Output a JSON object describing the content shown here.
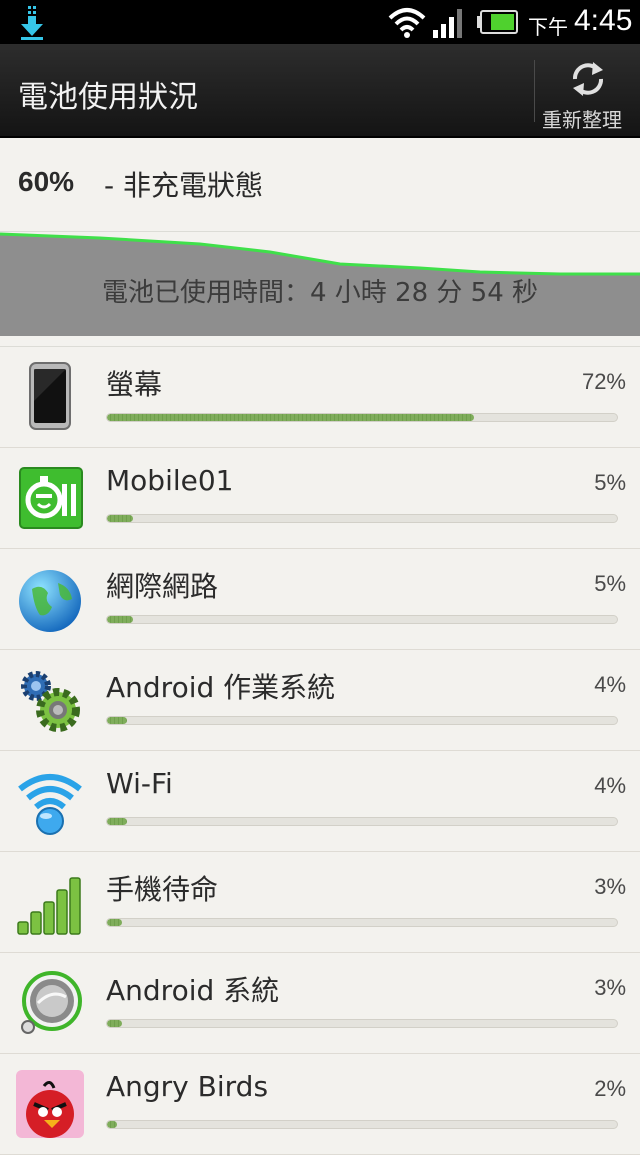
{
  "status_bar": {
    "ampm": "下午",
    "time": "4:45",
    "icons": [
      "download-icon",
      "wifi-icon",
      "signal-icon",
      "battery-icon"
    ]
  },
  "header": {
    "title": "電池使用狀況",
    "refresh_label": "重新整理"
  },
  "summary": {
    "percent": "60%",
    "state": "- 非充電狀態"
  },
  "graph": {
    "usage_text": "電池已使用時間：4 小時 28 分 54 秒",
    "line_color": "#3fe04a",
    "fill_color": "#8e8e8e"
  },
  "usage": {
    "items": [
      {
        "name": "螢幕",
        "percent": "72%",
        "fraction": 0.72,
        "icon": "phone-screen-icon"
      },
      {
        "name": "Mobile01",
        "percent": "5%",
        "fraction": 0.05,
        "icon": "mobile01-app-icon"
      },
      {
        "name": "網際網路",
        "percent": "5%",
        "fraction": 0.05,
        "icon": "globe-icon"
      },
      {
        "name": "Android 作業系統",
        "percent": "4%",
        "fraction": 0.04,
        "icon": "gears-icon"
      },
      {
        "name": "Wi-Fi",
        "percent": "4%",
        "fraction": 0.04,
        "icon": "wifi-icon"
      },
      {
        "name": "手機待命",
        "percent": "3%",
        "fraction": 0.03,
        "icon": "signal-bars-icon"
      },
      {
        "name": "Android 系統",
        "percent": "3%",
        "fraction": 0.03,
        "icon": "android-system-icon"
      },
      {
        "name": "Angry Birds",
        "percent": "2%",
        "fraction": 0.02,
        "icon": "angry-birds-icon"
      }
    ]
  }
}
